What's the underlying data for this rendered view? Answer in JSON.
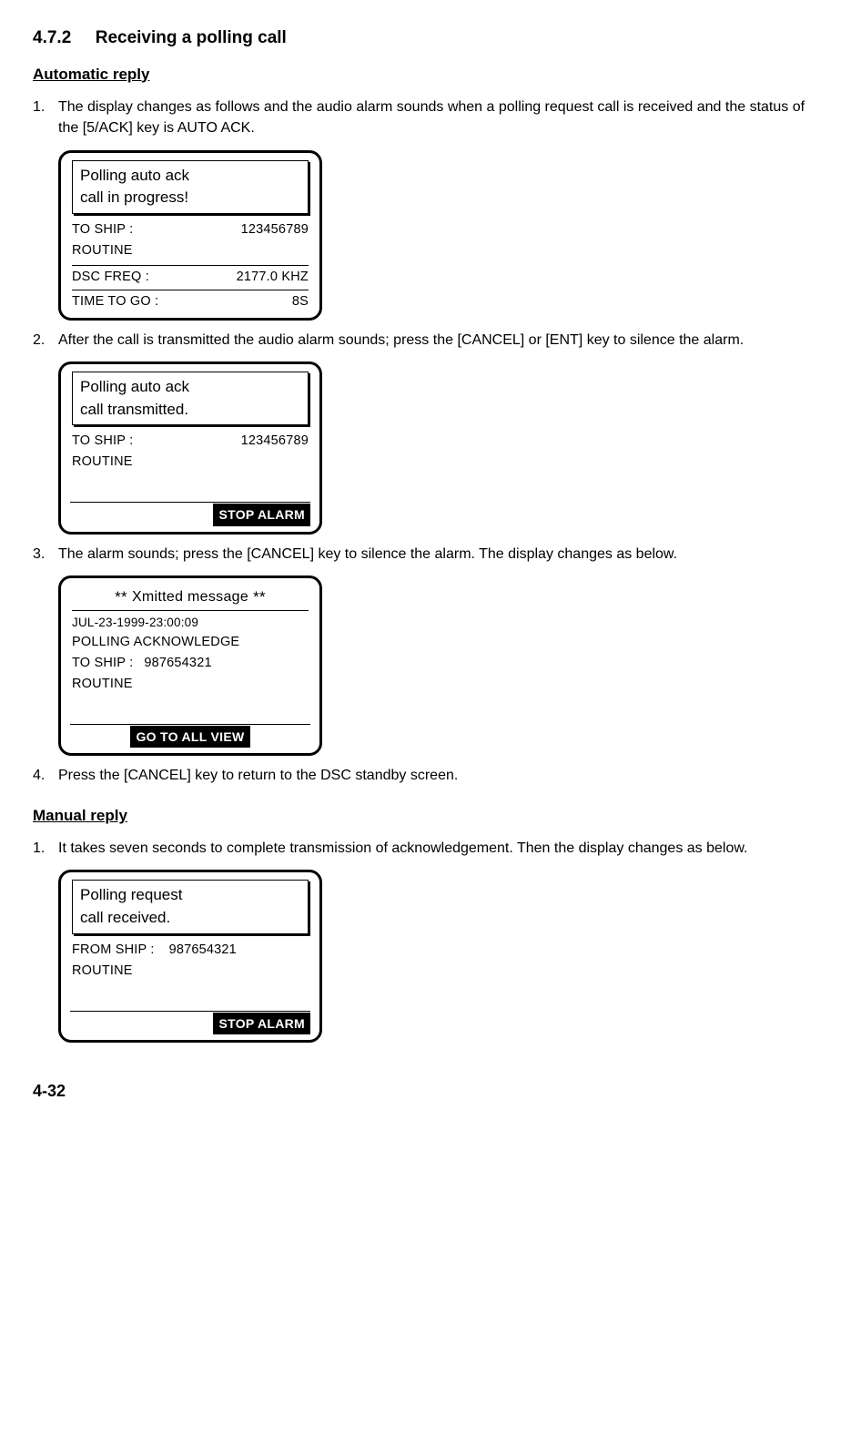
{
  "section": {
    "number": "4.7.2",
    "title": "Receiving a polling call"
  },
  "auto": {
    "heading": "Automatic reply",
    "steps": {
      "s1": {
        "num": "1.",
        "text": "The display changes as follows and the audio alarm sounds when a polling request call is received and the status of the [5/ACK] key is AUTO ACK."
      },
      "s2": {
        "num": "2.",
        "text": "After the call is transmitted the audio alarm sounds; press the [CANCEL] or [ENT] key to silence the alarm."
      },
      "s3": {
        "num": "3.",
        "text": "The alarm sounds; press the [CANCEL] key to silence the alarm. The display changes as below."
      },
      "s4": {
        "num": "4.",
        "text": "Press the [CANCEL] key to return to the DSC standby screen."
      }
    },
    "screen1": {
      "l1": "Polling auto ack",
      "l2": "call in progress!",
      "toship_label": "TO SHIP :",
      "toship_val": "123456789",
      "priority": "ROUTINE",
      "dsc_label": "DSC FREQ    :",
      "dsc_val": "2177.0 KHZ",
      "ttg_label": "TIME TO GO :",
      "ttg_val": "8S"
    },
    "screen2": {
      "l1": "Polling auto ack",
      "l2": "call transmitted.",
      "toship_label": "TO SHIP :",
      "toship_val": "123456789",
      "priority": "ROUTINE",
      "button": "STOP ALARM"
    },
    "screen3": {
      "header_pre": "** ",
      "header_mid": "Xmitted message",
      "header_post": " **",
      "timestamp": "JUL-23-1999-23:00:09",
      "line1": "POLLING  ACKNOWLEDGE",
      "toship_label": "TO SHIP :",
      "toship_val": "987654321",
      "priority": "ROUTINE",
      "button": "GO TO ALL VIEW"
    }
  },
  "manual": {
    "heading": "Manual reply",
    "steps": {
      "s1": {
        "num": "1.",
        "text": "It takes seven seconds to complete transmission of acknowledgement. Then the display changes as below."
      }
    },
    "screen1": {
      "l1": "Polling request",
      "l2": "call received.",
      "fromship_label": "FROM SHIP :",
      "fromship_val": "987654321",
      "priority": "ROUTINE",
      "button": "STOP ALARM"
    }
  },
  "page_number": "4-32"
}
